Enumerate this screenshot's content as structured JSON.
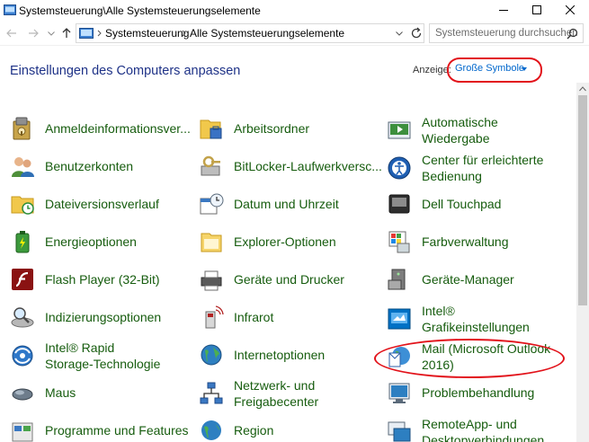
{
  "window": {
    "title": "Systemsteuerung\\Alle Systemsteuerungselemente",
    "minimize_icon": "minimize-icon",
    "maximize_icon": "maximize-icon",
    "close_icon": "close-icon"
  },
  "nav": {
    "breadcrumbs": [
      "Systemsteuerung",
      "Alle Systemsteuerungselemente"
    ],
    "search_placeholder": "Systemsteuerung durchsuchen"
  },
  "header": {
    "title": "Einstellungen des Computers anpassen",
    "view_label": "Anzeige:",
    "view_value": "Große Symbole"
  },
  "columns": [
    [
      {
        "label": "Anmeldeinformationsver...",
        "icon": "credential-manager-icon"
      },
      {
        "label": "Benutzerkonten",
        "icon": "user-accounts-icon"
      },
      {
        "label": "Dateiversionsverlauf",
        "icon": "file-history-icon"
      },
      {
        "label": "Energieoptionen",
        "icon": "power-options-icon"
      },
      {
        "label": "Flash Player (32-Bit)",
        "icon": "flash-player-icon"
      },
      {
        "label": "Indizierungsoptionen",
        "icon": "indexing-options-icon"
      },
      {
        "label": "Intel® Rapid\nStorage-Technologie",
        "icon": "intel-rapid-storage-icon"
      },
      {
        "label": "Maus",
        "icon": "mouse-icon"
      },
      {
        "label": "Programme und Features",
        "icon": "programs-features-icon"
      }
    ],
    [
      {
        "label": "Arbeitsordner",
        "icon": "work-folders-icon"
      },
      {
        "label": "BitLocker-Laufwerkversc...",
        "icon": "bitlocker-icon"
      },
      {
        "label": "Datum und Uhrzeit",
        "icon": "date-time-icon"
      },
      {
        "label": "Explorer-Optionen",
        "icon": "explorer-options-icon"
      },
      {
        "label": "Geräte und Drucker",
        "icon": "devices-printers-icon"
      },
      {
        "label": "Infrarot",
        "icon": "infrared-icon"
      },
      {
        "label": "Internetoptionen",
        "icon": "internet-options-icon"
      },
      {
        "label": "Netzwerk- und\nFreigabecenter",
        "icon": "network-sharing-icon"
      },
      {
        "label": "Region",
        "icon": "region-icon"
      }
    ],
    [
      {
        "label": "Automatische\nWiedergabe",
        "icon": "autoplay-icon"
      },
      {
        "label": "Center für erleichterte\nBedienung",
        "icon": "ease-of-access-icon"
      },
      {
        "label": "Dell Touchpad",
        "icon": "touchpad-icon"
      },
      {
        "label": "Farbverwaltung",
        "icon": "color-management-icon"
      },
      {
        "label": "Geräte-Manager",
        "icon": "device-manager-icon"
      },
      {
        "label": "Intel®\nGrafikeinstellungen",
        "icon": "intel-graphics-icon"
      },
      {
        "label": "Mail (Microsoft Outlook\n2016)",
        "icon": "mail-icon"
      },
      {
        "label": "Problembehandlung",
        "icon": "troubleshooting-icon"
      },
      {
        "label": "RemoteApp- und\nDesktopverbindungen",
        "icon": "remoteapp-icon"
      }
    ]
  ],
  "colors": {
    "link_green": "#165c0e",
    "title_blue": "#1e3287",
    "highlight_red": "#e2121a",
    "view_blue": "#0066cc"
  }
}
